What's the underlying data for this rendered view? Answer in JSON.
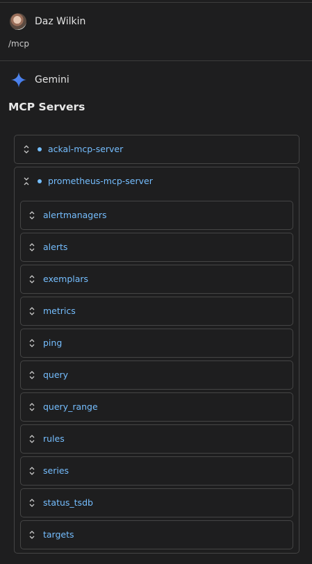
{
  "user": {
    "name": "Daz Wilkin",
    "message": "/mcp"
  },
  "assistant": {
    "name": "Gemini",
    "icon": "gemini-sparkle-icon",
    "icon_color": "#4a8cf7"
  },
  "section_title": "MCP Servers",
  "accent_color": "#75beff",
  "servers": [
    {
      "label": "ackal-mcp-server",
      "expanded": false
    },
    {
      "label": "prometheus-mcp-server",
      "expanded": true,
      "tools": [
        "alertmanagers",
        "alerts",
        "exemplars",
        "metrics",
        "ping",
        "query",
        "query_range",
        "rules",
        "series",
        "status_tsdb",
        "targets"
      ]
    }
  ]
}
